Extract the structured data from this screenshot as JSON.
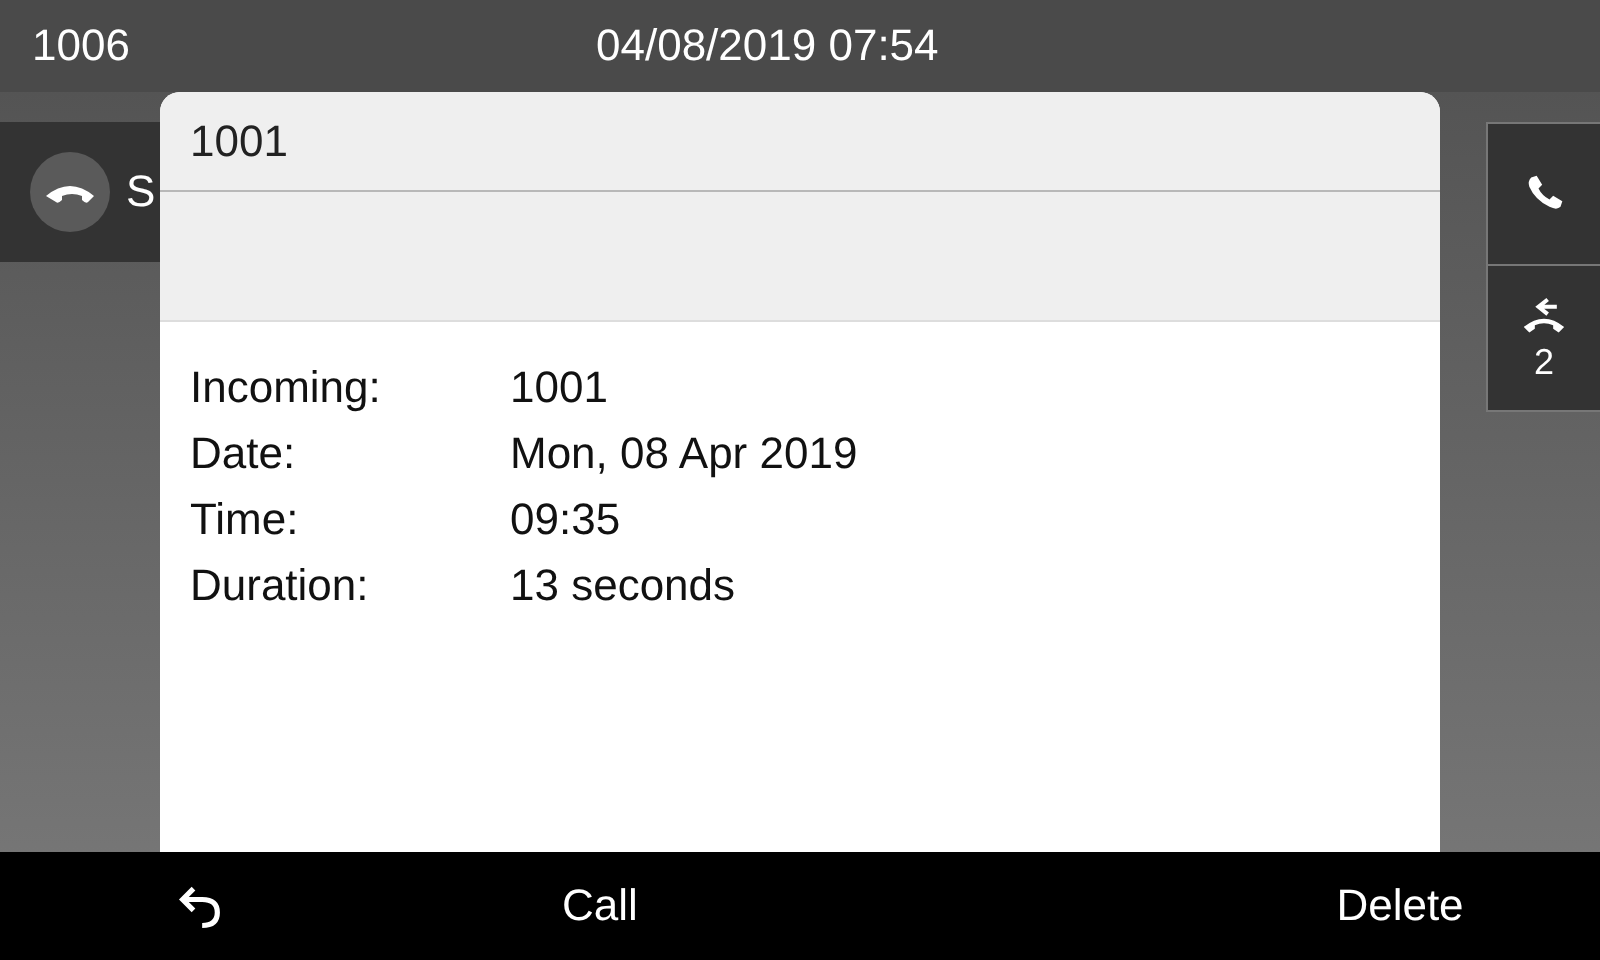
{
  "header": {
    "extension": "1006",
    "datetime": "04/08/2019 07:54"
  },
  "line": {
    "label": "S"
  },
  "side_buttons": [
    {
      "kind": "call"
    },
    {
      "kind": "recent",
      "count": "2"
    }
  ],
  "dialog": {
    "title": "1001",
    "details": [
      {
        "label": "Incoming:",
        "value": "1001"
      },
      {
        "label": "Date:",
        "value": "Mon, 08 Apr 2019"
      },
      {
        "label": "Time:",
        "value": "09:35"
      },
      {
        "label": "Duration:",
        "value": "13 seconds"
      }
    ]
  },
  "softkeys": [
    {
      "kind": "back"
    },
    {
      "kind": "text",
      "label": "Call"
    },
    {
      "kind": "text",
      "label": "Delete"
    }
  ]
}
